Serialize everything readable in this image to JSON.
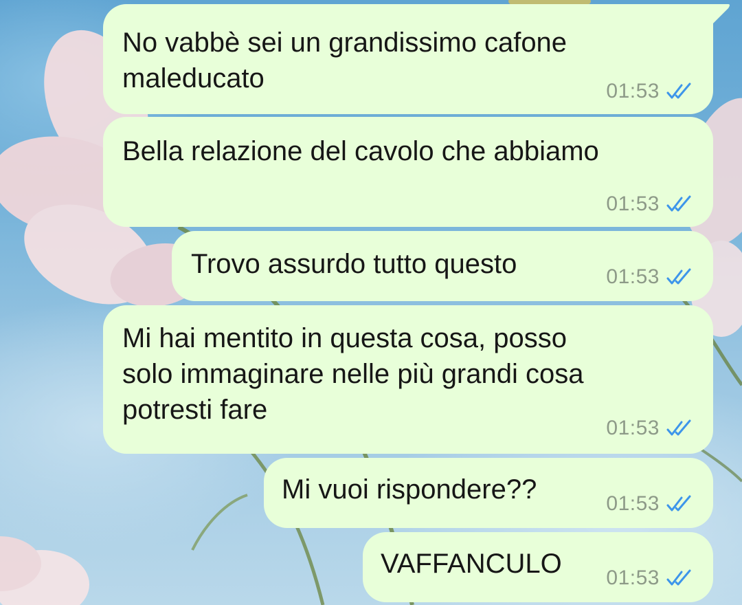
{
  "chat": {
    "messages": [
      {
        "lines": [
          "No vabbè sei un grandissimo cafone",
          "maleducato"
        ],
        "time": "01:53",
        "status_icon": "double-check-read-icon"
      },
      {
        "lines": [
          "Bella relazione del cavolo che abbiamo"
        ],
        "time": "01:53",
        "status_icon": "double-check-read-icon"
      },
      {
        "lines": [
          "Trovo assurdo tutto questo"
        ],
        "time": "01:53",
        "status_icon": "double-check-read-icon"
      },
      {
        "lines": [
          "Mi hai mentito in questa cosa, posso",
          "solo immaginare nelle più grandi cosa",
          "potresti fare"
        ],
        "time": "01:53",
        "status_icon": "double-check-read-icon"
      },
      {
        "lines": [
          "Mi vuoi rispondere??"
        ],
        "time": "01:53",
        "status_icon": "double-check-read-icon"
      },
      {
        "lines": [
          "VAFFANCULO"
        ],
        "time": "01:53",
        "status_icon": "double-check-read-icon"
      }
    ]
  },
  "colors": {
    "bubble_outgoing": "#e8ffd9",
    "text": "#161616",
    "time": "#8d9a88",
    "read_ticks": "#3d95ea"
  }
}
